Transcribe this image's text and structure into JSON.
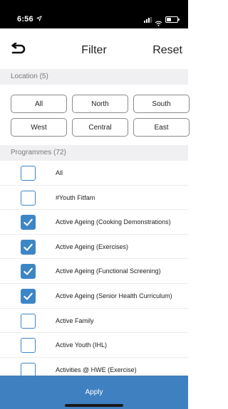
{
  "status_bar": {
    "time": "6:56",
    "location_arrow": "location-arrow-icon",
    "icons": [
      "signal-icon",
      "wifi-icon",
      "battery-icon"
    ]
  },
  "navbar": {
    "back_icon": "back-arrow-icon",
    "title": "Filter",
    "reset_label": "Reset"
  },
  "location": {
    "header": "Location (5)",
    "options": [
      "All",
      "North",
      "South",
      "West",
      "Central",
      "East"
    ]
  },
  "programmes": {
    "header": "Programmes (72)",
    "items": [
      {
        "label": "All",
        "checked": false
      },
      {
        "label": "#Youth Fitfam",
        "checked": false
      },
      {
        "label": "Active Ageing (Cooking Demonstrations)",
        "checked": true
      },
      {
        "label": "Active Ageing (Exercises)",
        "checked": true
      },
      {
        "label": "Active Ageing (Functional Screening)",
        "checked": true
      },
      {
        "label": "Active Ageing (Senior Health Curriculum)",
        "checked": true
      },
      {
        "label": "Active Family",
        "checked": false
      },
      {
        "label": "Active Youth (IHL)",
        "checked": false
      },
      {
        "label": "Activities @ HWE (Exercise)",
        "checked": false
      }
    ]
  },
  "apply_label": "Apply",
  "colors": {
    "accent": "#3d86c6",
    "apply_bg": "#3f80c0",
    "section_bg": "#f0f0f2"
  }
}
